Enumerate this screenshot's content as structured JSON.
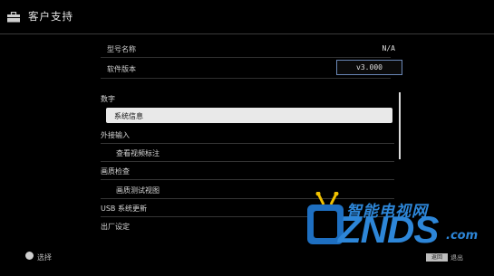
{
  "header": {
    "title": "客户支持",
    "icon": "briefcase-icon"
  },
  "info": [
    {
      "label": "型号名称",
      "value": "N/A"
    },
    {
      "label": "软件版本",
      "value": "v3.000"
    }
  ],
  "menu": [
    {
      "label": "数字",
      "indent": false,
      "selected": false
    },
    {
      "label": "系统信息",
      "indent": true,
      "selected": true
    },
    {
      "label": "外接输入",
      "indent": false,
      "selected": false
    },
    {
      "label": "查看视频标注",
      "indent": true,
      "selected": false
    },
    {
      "label": "画质检查",
      "indent": false,
      "selected": false
    },
    {
      "label": "画质测试视图",
      "indent": true,
      "selected": false
    },
    {
      "label": "USB 系统更新",
      "indent": false,
      "selected": false
    },
    {
      "label": "出厂设定",
      "indent": false,
      "selected": false
    }
  ],
  "footer": {
    "select_label": "选择",
    "back_key": "返回",
    "exit_label": "退出"
  },
  "watermark": {
    "cn": "智能电视网",
    "brand": "ZNDS",
    "domain": ".com"
  },
  "colors": {
    "background": "#000000",
    "highlight": "#e9e9e9",
    "watermark": "#2d86d8",
    "value_box_border": "#6b88b8"
  }
}
